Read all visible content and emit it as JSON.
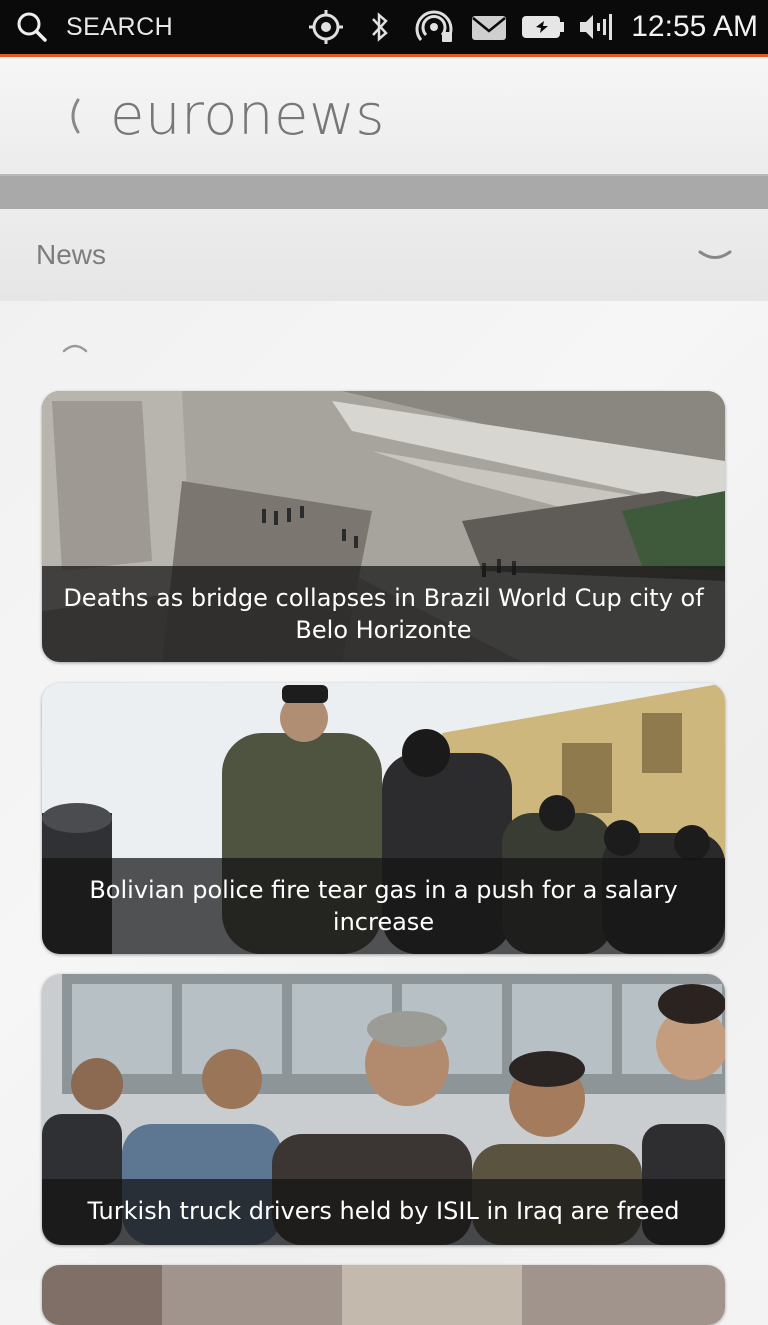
{
  "status_bar": {
    "search_label": "SEARCH",
    "time": "12:55 AM",
    "icons": [
      "search-icon",
      "location-icon",
      "bluetooth-icon",
      "hotspot-icon",
      "mail-icon",
      "battery-icon",
      "volume-icon"
    ]
  },
  "header": {
    "title": "euronews",
    "back_icon": "back-chevron-icon"
  },
  "department": {
    "label": "News",
    "dropdown_icon": "chevron-down-icon"
  },
  "content": {
    "collapse_icon": "chevron-up-icon",
    "articles": [
      {
        "caption": "Deaths as bridge collapses in Brazil World Cup city of Belo Horizonte"
      },
      {
        "caption": "Bolivian police fire tear gas in a push for a salary increase"
      },
      {
        "caption": "Turkish truck drivers held by ISIL in Iraq are freed"
      }
    ]
  },
  "colors": {
    "accent": "#e05a26",
    "status_bar_bg": "#0a0a0a",
    "title_text": "#777777",
    "caption_bg": "#141414"
  }
}
